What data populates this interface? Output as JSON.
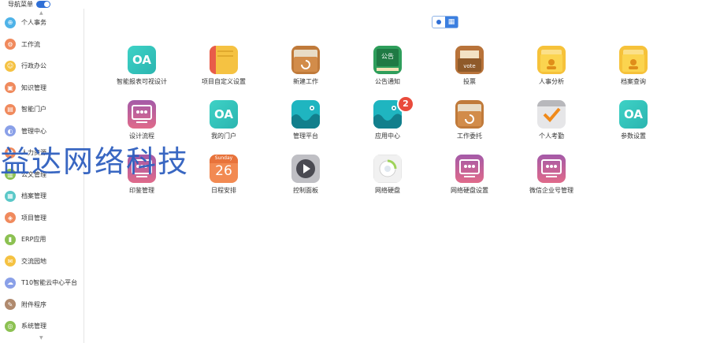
{
  "nav_toggle": {
    "label": "导航菜单"
  },
  "sidebar": {
    "items": [
      {
        "label": "个人事务",
        "color": "#4fb3e8",
        "glyph": "⊕"
      },
      {
        "label": "工作流",
        "color": "#f08a5d",
        "glyph": "⚙"
      },
      {
        "label": "行政办公",
        "color": "#f5c242",
        "glyph": "☺"
      },
      {
        "label": "知识管理",
        "color": "#f08a5d",
        "glyph": "▣"
      },
      {
        "label": "智能门户",
        "color": "#f08a5d",
        "glyph": "▤"
      },
      {
        "label": "管理中心",
        "color": "#8aa0e8",
        "glyph": "◐"
      },
      {
        "label": "人力资源",
        "color": "#f08a5d",
        "glyph": "☻"
      },
      {
        "label": "公文管理",
        "color": "#8cc152",
        "glyph": "▥"
      },
      {
        "label": "档案管理",
        "color": "#5ac8c8",
        "glyph": "▦"
      },
      {
        "label": "项目管理",
        "color": "#f08a5d",
        "glyph": "◈"
      },
      {
        "label": "ERP应用",
        "color": "#8cc152",
        "glyph": "▮"
      },
      {
        "label": "交流园地",
        "color": "#f5c242",
        "glyph": "✉"
      },
      {
        "label": "T10智能云中心平台",
        "color": "#8aa0e8",
        "glyph": "☁"
      },
      {
        "label": "附件程序",
        "color": "#b08a6e",
        "glyph": "✎"
      },
      {
        "label": "系统管理",
        "color": "#8cc152",
        "glyph": "◎"
      }
    ]
  },
  "apps": [
    {
      "label": "智能报表可视设计",
      "icon": "oa-icon",
      "style": "oa",
      "text": "OA"
    },
    {
      "label": "项目自定义设置",
      "icon": "notebook-icon",
      "style": "notebook"
    },
    {
      "label": "新建工作",
      "icon": "new-work-icon",
      "style": "brownbox"
    },
    {
      "label": "公告通知",
      "icon": "notice-board-icon",
      "style": "greenboard",
      "text": "公告"
    },
    {
      "label": "投票",
      "icon": "vote-icon",
      "style": "vote",
      "text": "vote"
    },
    {
      "label": "人事分析",
      "icon": "folder-card-icon",
      "style": "yellowfolder"
    },
    {
      "label": "档案查询",
      "icon": "folder-card-icon",
      "style": "yellowfolder"
    },
    {
      "label": "设计流程",
      "icon": "meeting-icon",
      "style": "purple"
    },
    {
      "label": "我的门户",
      "icon": "oa-icon",
      "style": "oa",
      "text": "OA"
    },
    {
      "label": "管理平台",
      "icon": "wave-icon",
      "style": "wave"
    },
    {
      "label": "应用中心",
      "icon": "wave-icon",
      "style": "wave",
      "badge": "2"
    },
    {
      "label": "工作委托",
      "icon": "new-work-icon",
      "style": "brownbox"
    },
    {
      "label": "个人考勤",
      "icon": "calendar-check-icon",
      "style": "checkcal"
    },
    {
      "label": "参数设置",
      "icon": "oa-icon",
      "style": "oa",
      "text": "OA"
    },
    {
      "label": "印鉴管理",
      "icon": "meeting-icon",
      "style": "purple"
    },
    {
      "label": "日程安排",
      "icon": "calendar-icon",
      "style": "calendar",
      "day": "Sunday",
      "date": "26"
    },
    {
      "label": "控制面板",
      "icon": "play-icon",
      "style": "play"
    },
    {
      "label": "网络硬盘",
      "icon": "disk-icon",
      "style": "disk"
    },
    {
      "label": "网络硬盘设置",
      "icon": "meeting-icon",
      "style": "purple"
    },
    {
      "label": "微信企业号管理",
      "icon": "meeting-icon",
      "style": "purple"
    }
  ],
  "watermark": {
    "text": "益达网络科技"
  },
  "colors": {
    "accent": "#2f6fd6",
    "badge": "#e94b3c",
    "watermark": "#2f5fbf"
  }
}
